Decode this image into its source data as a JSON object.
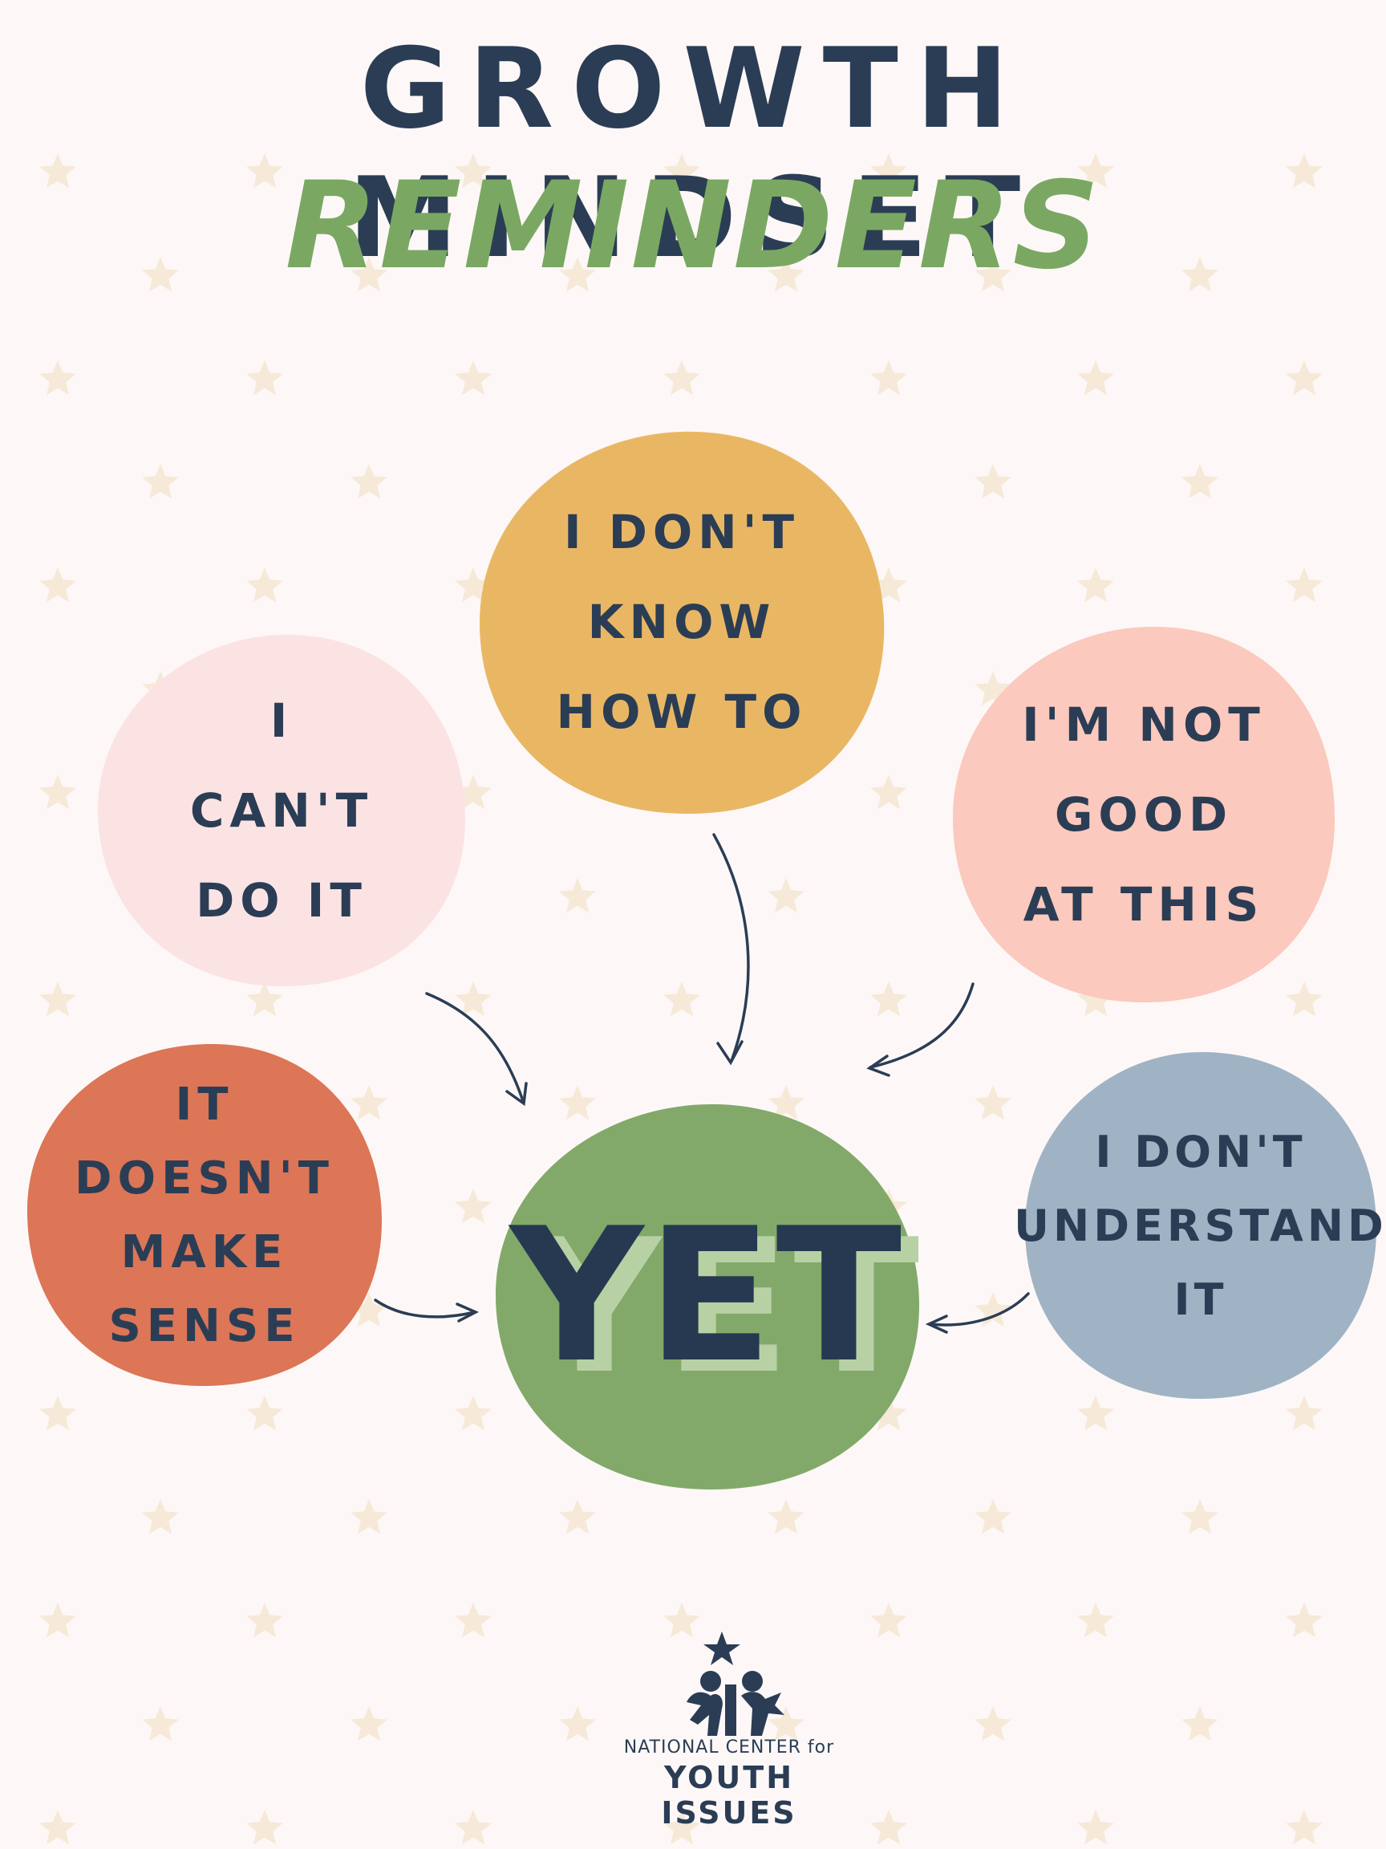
{
  "title": {
    "line1": "GROWTH MINDSET",
    "line2": "REMINDERS"
  },
  "bubbles": [
    {
      "id": "dont-know-how",
      "text": "I DON'T\nKNOW\nHOW TO",
      "color": "#e9b764"
    },
    {
      "id": "cant-do-it",
      "text": "I\nCAN'T\nDO IT",
      "color": "#fbe3e4"
    },
    {
      "id": "not-good",
      "text": "I'M NOT\nGOOD\nAT THIS",
      "color": "#fbc9bd"
    },
    {
      "id": "doesnt-make-sense",
      "text": "IT\nDOESN'T\nMAKE\nSENSE",
      "color": "#dc7656"
    },
    {
      "id": "dont-understand",
      "text": "I DON'T\nUNDERSTAND\nIT",
      "color": "#9fb3c4"
    }
  ],
  "center": {
    "text": "YET",
    "color": "#82a969",
    "shadow_color": "#b7d1a5"
  },
  "logo": {
    "line1": "NATIONAL CENTER for",
    "line2": "YOUTH ISSUES"
  },
  "colors": {
    "ink": "#2b3d55",
    "green": "#7aa862",
    "background": "#fdf8f7",
    "star": "#f6e9d8"
  }
}
